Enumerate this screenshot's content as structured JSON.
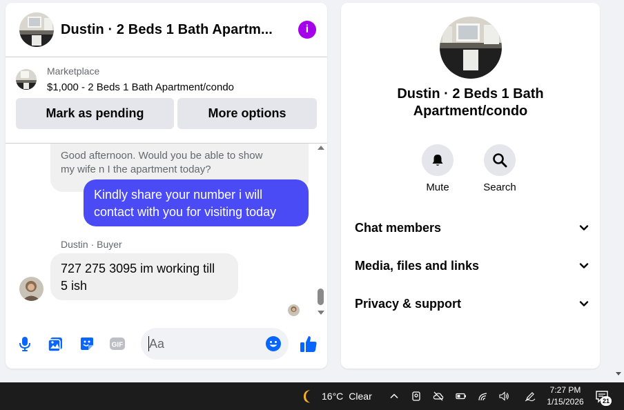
{
  "chat": {
    "title": "Dustin · 2 Beds 1 Bath Apartm...",
    "info_icon": "i",
    "listing": {
      "label": "Marketplace",
      "price_title": "$1,000 - 2 Beds 1 Bath Apartment/condo"
    },
    "actions": {
      "pending_label": "Mark as pending",
      "more_label": "More options"
    },
    "messages": [
      {
        "direction": "incoming",
        "text_line1": "Good afternoon. Would you be able to show",
        "text_line2": "my wife n I the apartment today?"
      },
      {
        "direction": "outgoing",
        "text_line1": "Kindly share your number i will",
        "text_line2": "contact with you for visiting today"
      },
      {
        "direction": "incoming",
        "sender": "Dustin · Buyer",
        "text_line1": "727 275 3095  im working till",
        "text_line2": "5 ish"
      }
    ],
    "composer": {
      "placeholder": "Aa",
      "icons": [
        "microphone-icon",
        "photo-icon",
        "sticker-icon",
        "gif-icon",
        "emoji-icon",
        "thumbs-up-icon"
      ]
    }
  },
  "info_panel": {
    "title": "Dustin · 2 Beds 1 Bath Apartment/condo",
    "quick_actions": [
      {
        "label": "Mute",
        "icon": "bell-icon"
      },
      {
        "label": "Search",
        "icon": "search-icon"
      }
    ],
    "sections": [
      {
        "label": "Chat members"
      },
      {
        "label": "Media, files and links"
      },
      {
        "label": "Privacy & support"
      }
    ]
  },
  "taskbar": {
    "weather_temp": "16°C",
    "weather_condition": "Clear",
    "time": "7:27 PM",
    "date": "1/15/2026",
    "notification_count": "21"
  },
  "colors": {
    "accent": "#0866ff",
    "outgoing_bubble": "#4b4bf5",
    "info_purple": "#a500ea",
    "panel_bg": "#f0f2f5"
  }
}
